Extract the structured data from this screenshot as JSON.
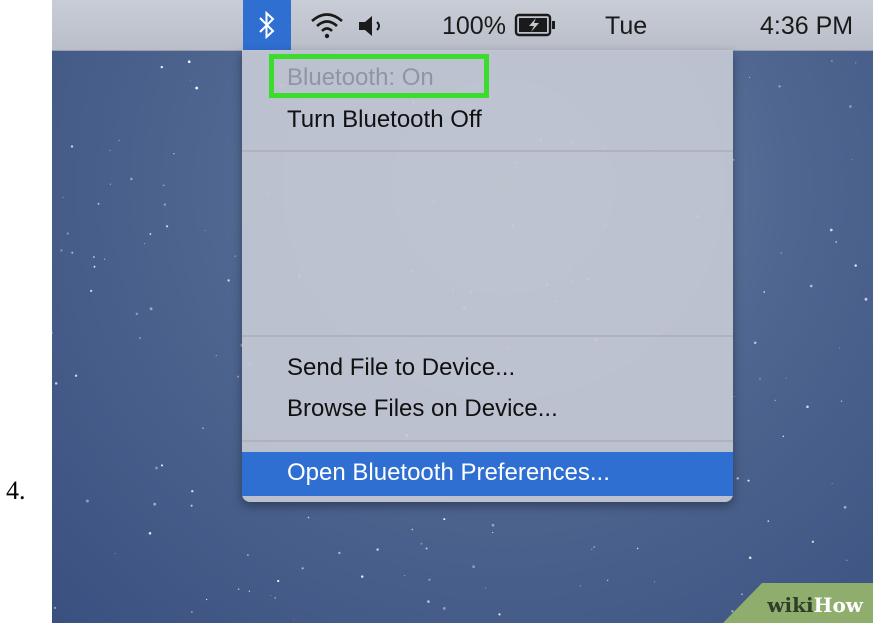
{
  "step_number": "4.",
  "menubar": {
    "icons": [
      "bluetooth-icon",
      "wifi-icon",
      "volume-icon",
      "battery-icon"
    ],
    "battery_percent": "100%",
    "day": "Tue",
    "time": "4:36 PM",
    "active_color": "#2f6fd1"
  },
  "menu": {
    "status": "Bluetooth: On",
    "toggle": "Turn Bluetooth Off",
    "send_file": "Send File to Device...",
    "browse_files": "Browse Files on Device...",
    "open_prefs": "Open Bluetooth Preferences..."
  },
  "callout_color": "#3bdc2c",
  "watermark": {
    "part1": "wiki",
    "part2": "How"
  }
}
